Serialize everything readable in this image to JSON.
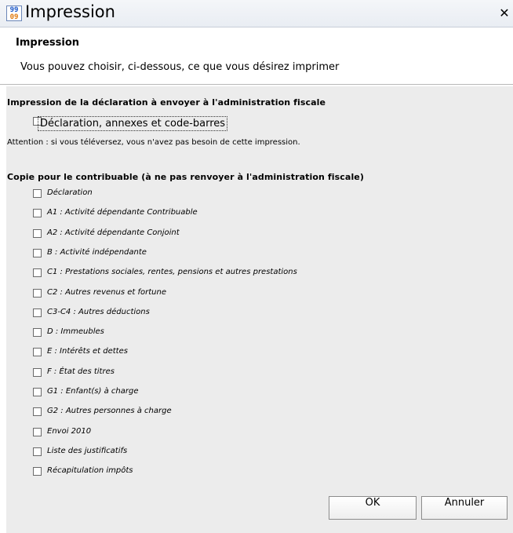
{
  "window": {
    "title": "Impression",
    "icon": {
      "name": "app-icon",
      "top": "99",
      "bottom": "09"
    },
    "close_glyph": "✕"
  },
  "header": {
    "title": "Impression",
    "description": "Vous pouvez choisir, ci-dessous, ce que vous désirez imprimer"
  },
  "section1": {
    "title": "Impression de la déclaration à envoyer à l'administration fiscale",
    "checkbox_label": "Déclaration, annexes et code-barres",
    "checked": false,
    "note": "Attention : si vous téléversez, vous n'avez pas besoin de cette impression."
  },
  "section2": {
    "title": "Copie pour le contribuable (à ne pas renvoyer à l'administration fiscale)",
    "items": [
      {
        "label": "Déclaration",
        "checked": false
      },
      {
        "label": "A1 : Activité dépendante Contribuable",
        "checked": false
      },
      {
        "label": "A2 : Activité dépendante Conjoint",
        "checked": false
      },
      {
        "label": "B : Activité indépendante",
        "checked": false
      },
      {
        "label": "C1 : Prestations sociales, rentes, pensions et autres prestations",
        "checked": false
      },
      {
        "label": "C2 : Autres revenus et fortune",
        "checked": false
      },
      {
        "label": "C3-C4 : Autres déductions",
        "checked": false
      },
      {
        "label": "D : Immeubles",
        "checked": false
      },
      {
        "label": "E : Intérêts et dettes",
        "checked": false
      },
      {
        "label": "F : État des titres",
        "checked": false
      },
      {
        "label": "G1 : Enfant(s) à charge",
        "checked": false
      },
      {
        "label": "G2 : Autres personnes à charge",
        "checked": false
      },
      {
        "label": "Envoi 2010",
        "checked": false
      },
      {
        "label": "Liste des justificatifs",
        "checked": false
      },
      {
        "label": "Récapitulation impôts",
        "checked": false
      }
    ]
  },
  "buttons": {
    "ok": "OK",
    "cancel": "Annuler"
  }
}
